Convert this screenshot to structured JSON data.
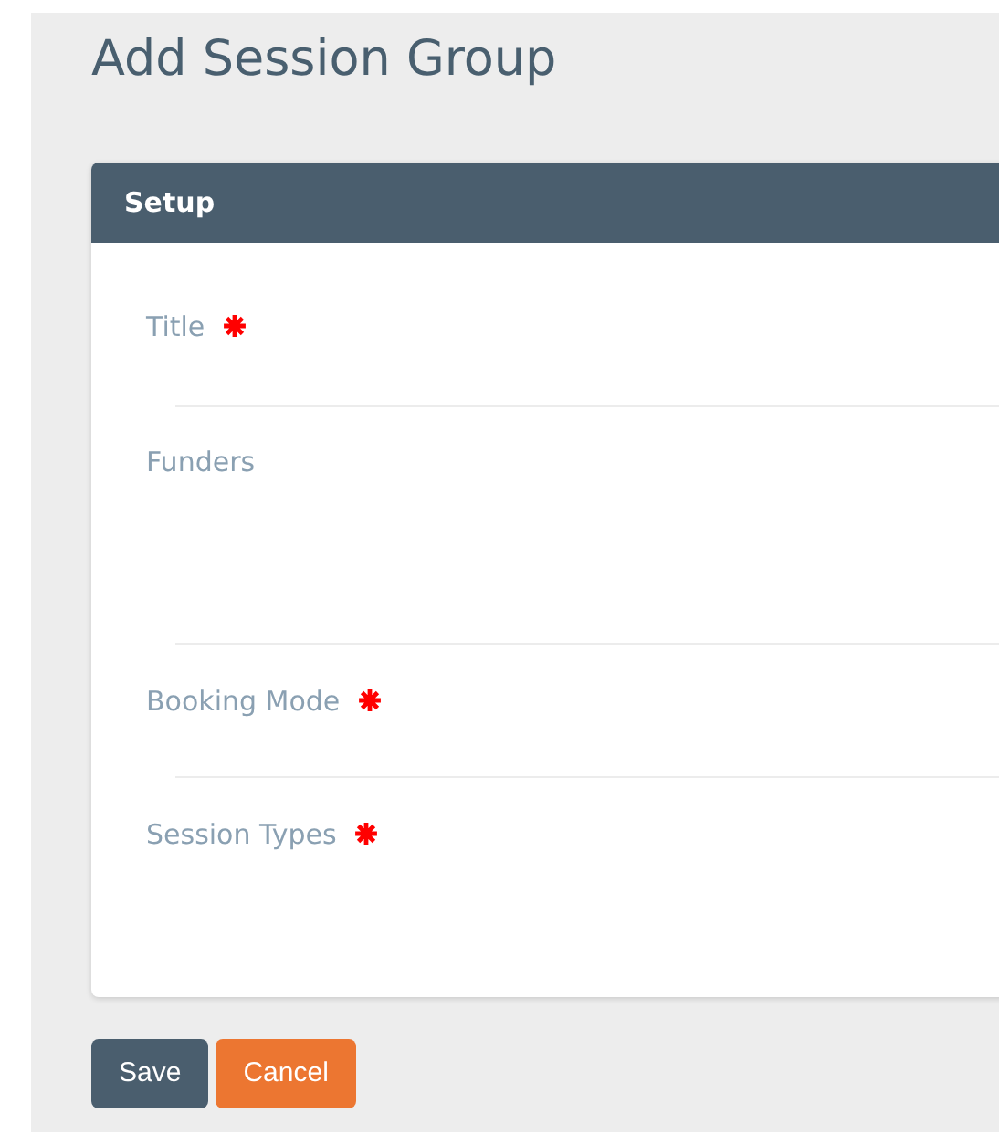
{
  "page": {
    "title": "Add Session Group"
  },
  "panel": {
    "title": "Setup"
  },
  "fields": [
    {
      "label": "Title",
      "required": true
    },
    {
      "label": "Funders",
      "required": false
    },
    {
      "label": "Booking Mode",
      "required": true
    },
    {
      "label": "Session Types",
      "required": true
    }
  ],
  "buttons": [
    {
      "label": "Save",
      "kind": "primary"
    },
    {
      "label": "Cancel",
      "kind": "secondary"
    }
  ]
}
